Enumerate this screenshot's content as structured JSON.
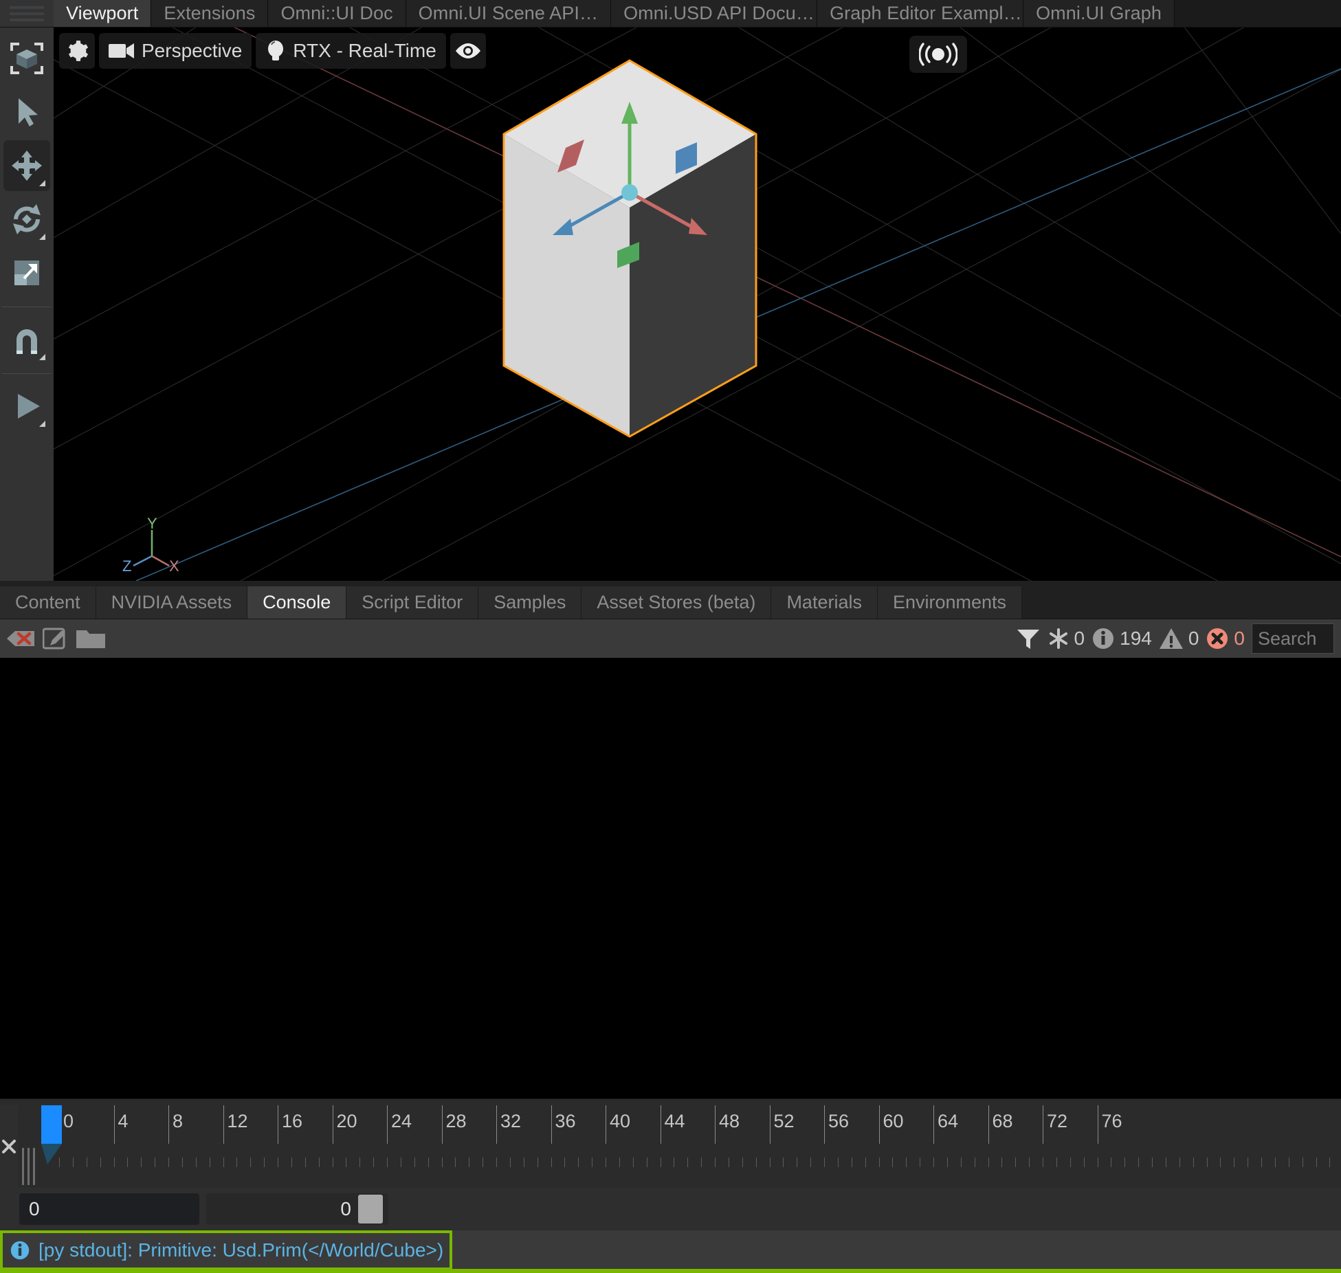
{
  "window": {
    "top_tabs": [
      {
        "label": "Viewport",
        "active": true
      },
      {
        "label": "Extensions",
        "active": false
      },
      {
        "label": "Omni::UI Doc",
        "active": false
      },
      {
        "label": "Omni.UI Scene API…",
        "active": false
      },
      {
        "label": "Omni.USD API Docu…",
        "active": false
      },
      {
        "label": "Graph Editor Exampl…",
        "active": false
      },
      {
        "label": "Omni.UI Graph",
        "active": false
      }
    ]
  },
  "left_toolbar": {
    "items": [
      {
        "name": "select-bound-tool",
        "icon": "cube-bracket-icon",
        "active": false
      },
      {
        "name": "select-tool",
        "icon": "pointer-arrow-icon",
        "active": false
      },
      {
        "name": "move-tool",
        "icon": "move-arrows-icon",
        "active": true
      },
      {
        "name": "rotate-tool",
        "icon": "rotate-icon",
        "active": false
      },
      {
        "name": "scale-tool",
        "icon": "scale-icon",
        "active": false
      },
      {
        "name": "snap-tool",
        "icon": "magnet-icon",
        "active": false
      },
      {
        "name": "play-tool",
        "icon": "play-triangle-icon",
        "active": false
      }
    ]
  },
  "viewport": {
    "toolbar": {
      "settings_icon": "gear-icon",
      "camera_icon": "camera-icon",
      "camera_label": "Perspective",
      "render_icon": "lightbulb-icon",
      "render_label": "RTX - Real-Time",
      "visibility_icon": "eye-icon",
      "capture_icon": "broadcast-icon"
    },
    "axis_indicator": {
      "x": "X",
      "y": "Y",
      "z": "Z"
    },
    "selection_outline_color": "#ff9e1b",
    "background_color": "#000000"
  },
  "bottom_tabs": [
    {
      "label": "Content",
      "active": false
    },
    {
      "label": "NVIDIA Assets",
      "active": false
    },
    {
      "label": "Console",
      "active": true
    },
    {
      "label": "Script Editor",
      "active": false
    },
    {
      "label": "Samples",
      "active": false
    },
    {
      "label": "Asset Stores (beta)",
      "active": false
    },
    {
      "label": "Materials",
      "active": false
    },
    {
      "label": "Environments",
      "active": false
    }
  ],
  "console_toolbar": {
    "clear_icon": "clear-log-icon",
    "edit_icon": "edit-pencil-icon",
    "open_icon": "open-folder-icon",
    "filter_icon": "filter-funnel-icon",
    "verbose_icon": "asterisk-icon",
    "verbose_count": "0",
    "info_icon": "info-circle-icon",
    "info_count": "194",
    "warning_icon": "warning-triangle-icon",
    "warning_count": "0",
    "error_icon": "error-circle-icon",
    "error_count": "0",
    "search_placeholder": "Search"
  },
  "console_log": {
    "lines": []
  },
  "timeline": {
    "ticks": [
      "0",
      "4",
      "8",
      "12",
      "16",
      "20",
      "24",
      "28",
      "32",
      "36",
      "40",
      "44",
      "48",
      "52",
      "56",
      "60",
      "64",
      "68",
      "72",
      "76"
    ],
    "playhead_frame": "0",
    "start_field_value": "0",
    "end_field_value": "0",
    "playhead_color": "#1a8cff"
  },
  "status_bar": {
    "icon": "info-circle-icon",
    "message": "[py stdout]: Primitive: Usd.Prim(</World/Cube>)",
    "message_color": "#5ab4e6",
    "highlight_color": "#7ab800"
  }
}
